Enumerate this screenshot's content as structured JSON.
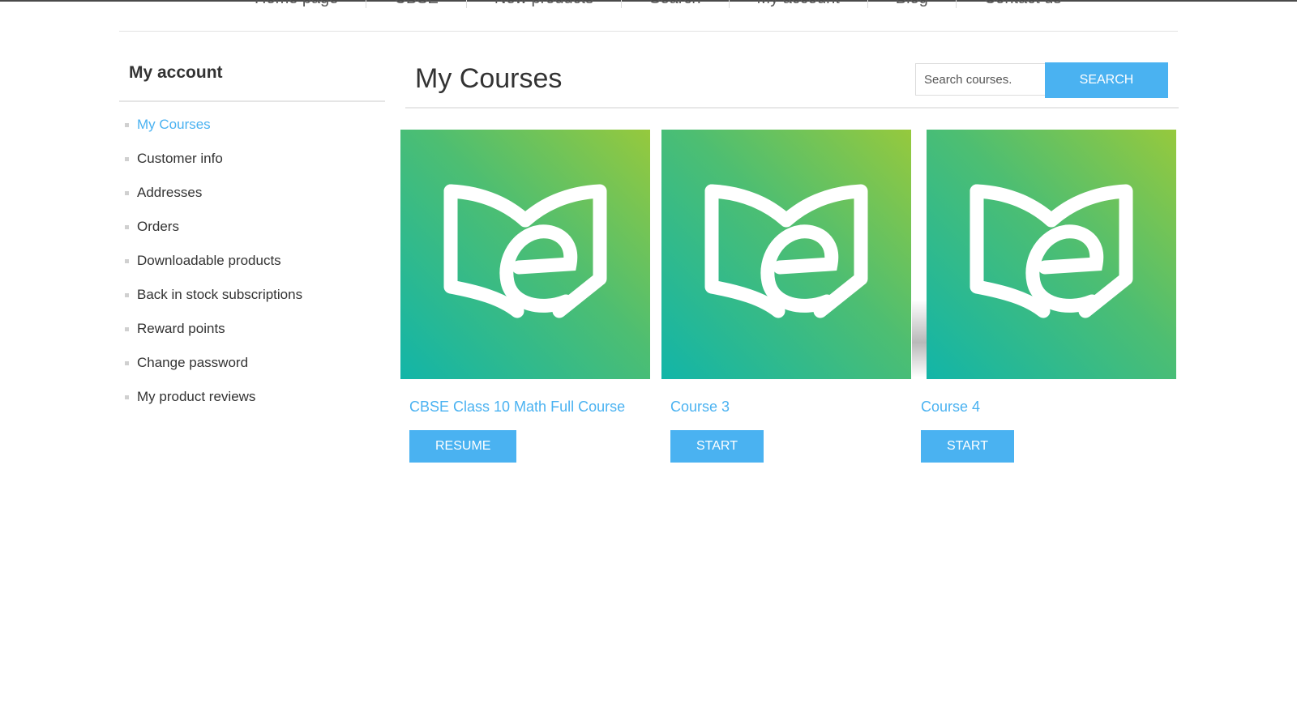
{
  "nav": {
    "items": [
      "Home page",
      "CBSE",
      "New products",
      "Search",
      "My account",
      "Blog",
      "Contact us"
    ]
  },
  "sidebar": {
    "title": "My account",
    "items": [
      {
        "label": "My Courses",
        "active": true
      },
      {
        "label": "Customer info"
      },
      {
        "label": "Addresses"
      },
      {
        "label": "Orders"
      },
      {
        "label": "Downloadable products"
      },
      {
        "label": "Back in stock subscriptions"
      },
      {
        "label": "Reward points"
      },
      {
        "label": "Change password"
      },
      {
        "label": "My product reviews"
      }
    ]
  },
  "main": {
    "title": "My Courses",
    "search": {
      "placeholder": "Search courses.",
      "button_label": "SEARCH"
    },
    "courses": [
      {
        "title": "CBSE Class 10 Math Full Course",
        "button_label": "RESUME",
        "icon": "open-book-e-icon"
      },
      {
        "title": "Course 3",
        "button_label": "START",
        "icon": "open-book-e-icon"
      },
      {
        "title": "Course 4",
        "button_label": "START",
        "icon": "open-book-e-icon"
      }
    ]
  },
  "colors": {
    "accent": "#4ab2f1",
    "gradient_start": "#12b5a8",
    "gradient_end": "#96c93d"
  }
}
